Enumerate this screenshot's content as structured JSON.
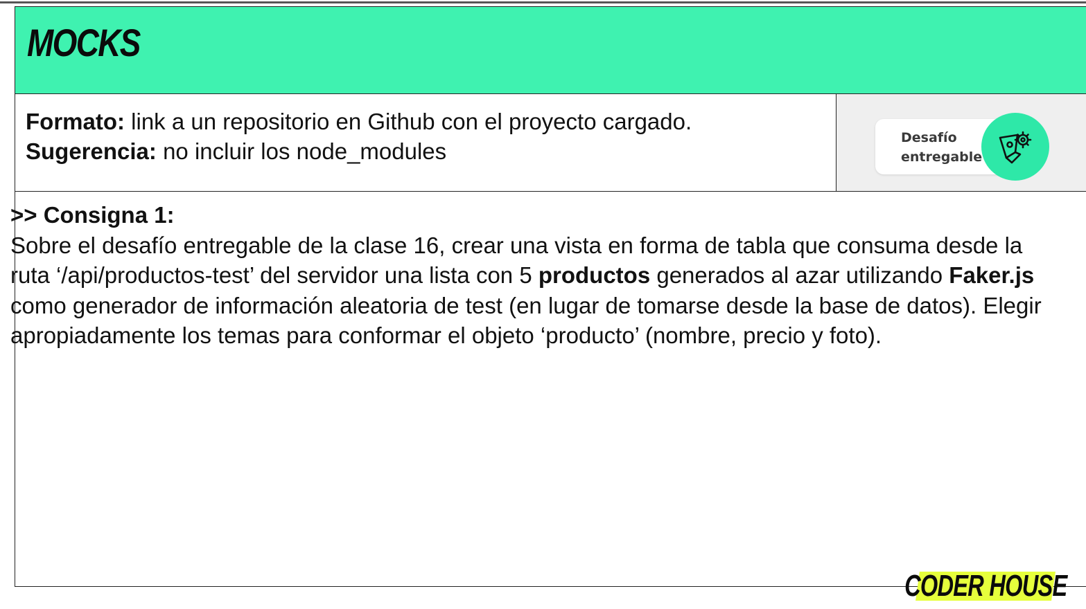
{
  "header": {
    "title": "MOCKS"
  },
  "format": {
    "formato_label": "Formato:",
    "formato_text": " link a un repositorio en Github con el proyecto cargado.",
    "sugerencia_label": "Sugerencia:",
    "sugerencia_text": " no incluir los node_modules"
  },
  "badge": {
    "line1": "Desafío",
    "line2": "entregable",
    "icon": "pen-gear-icon",
    "color": "#2ee8a8"
  },
  "consigna": {
    "heading": ">> Consigna 1:",
    "p1": "Sobre el desafío entregable de la clase 16, crear una vista en forma de tabla que consuma desde la ruta ‘/api/productos-test’ del servidor una lista con 5 ",
    "bold1": "productos",
    "p2": " generados al azar utilizando ",
    "bold2": "Faker.js",
    "p3": " como generador de información aleatoria de test (en lugar de tomarse desde la base de datos). Elegir apropiadamente los temas para conformar el objeto ‘producto’ (nombre, precio y foto)."
  },
  "footer": {
    "logo_text": "CODER HOUSE",
    "logo_color": "#e6ff3c"
  },
  "colors": {
    "header_band": "#3ff2b0",
    "badge_cell": "#efefef"
  }
}
